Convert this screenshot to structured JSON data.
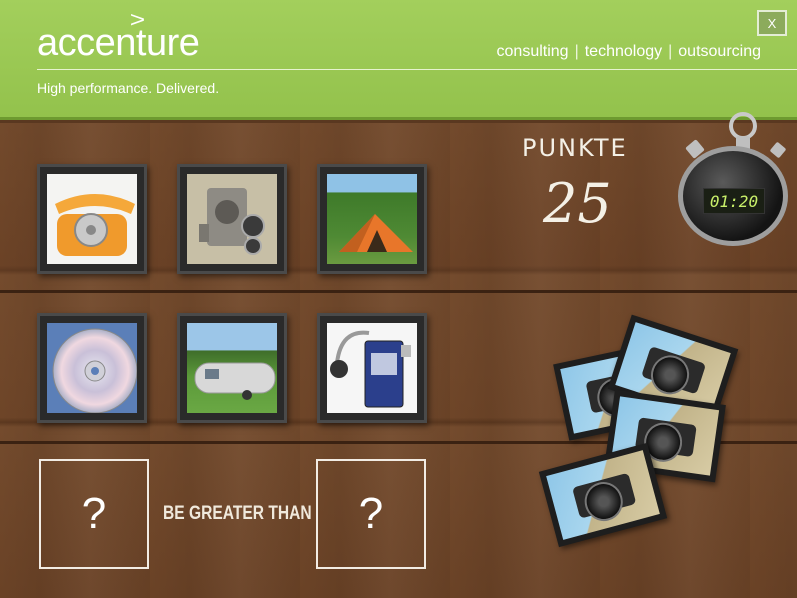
{
  "header": {
    "brand": "accenture",
    "brand_mark": ">",
    "tagline": "High performance. Delivered.",
    "services": [
      "consulting",
      "technology",
      "outsourcing"
    ],
    "separator": "|",
    "close_label": "X"
  },
  "game": {
    "score_label": "PUNKTE",
    "score_value": "25",
    "timer": "01:20",
    "slot_left": "?",
    "slot_right": "?",
    "comparison_text": "BE GREATER THAN",
    "tiles": [
      {
        "icon": "rotary-telephone-icon"
      },
      {
        "icon": "film-camera-icon"
      },
      {
        "icon": "tent-icon"
      },
      {
        "icon": "compact-disc-icon"
      },
      {
        "icon": "camper-trailer-icon"
      },
      {
        "icon": "walkman-icon"
      }
    ],
    "card_pile": {
      "icon": "camera-photo-icon",
      "count": 4
    }
  },
  "colors": {
    "header_green": "#9bc955",
    "wood": "#6b4226",
    "timer_digits": "#c9f06a"
  }
}
